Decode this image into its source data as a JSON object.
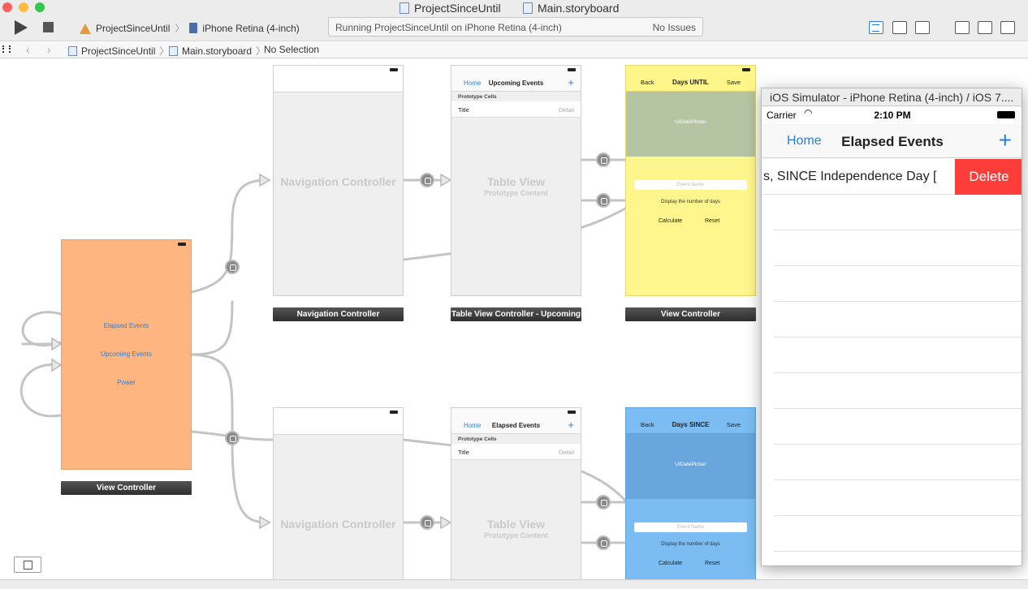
{
  "window": {
    "project_doc": "ProjectSinceUntil",
    "storyboard_doc": "Main.storyboard"
  },
  "toolbar": {
    "scheme": "ProjectSinceUntil",
    "device": "iPhone Retina (4-inch)",
    "status": "Running ProjectSinceUntil on iPhone Retina (4-inch)",
    "issues": "No Issues"
  },
  "jumpbar": {
    "project": "ProjectSinceUntil",
    "file": "Main.storyboard",
    "selection": "No Selection"
  },
  "storyboard": {
    "root_vc": {
      "buttons": [
        "Elapsed Events",
        "Upcoming Events",
        "Power"
      ],
      "label": "View Controller",
      "color": "#ffb57f"
    },
    "nav_top": {
      "watermark": "Navigation Controller",
      "label": "Navigation Controller"
    },
    "table_top": {
      "nav_left": "Home",
      "nav_title": "Upcoming Events",
      "nav_right": "+",
      "prototype": "Prototype Cells",
      "cell_title": "Title",
      "cell_detail": "Detail",
      "watermark": "Table View",
      "watermark_sub": "Prototype Content",
      "label": "Table View Controller - Upcoming"
    },
    "vc_until": {
      "back": "Back",
      "title": "Days UNTIL",
      "save": "Save",
      "picker": "UIDatePicker",
      "placeholder": "Event Name",
      "info": "Display the number of days",
      "calc": "Calculate",
      "reset": "Reset",
      "label": "View Controller",
      "color": "#fff78d",
      "picker_color": "#b5c4a3"
    },
    "nav_bottom": {
      "watermark": "Navigation Controller"
    },
    "table_bottom": {
      "nav_left": "Home",
      "nav_title": "Elapsed Events",
      "nav_right": "+",
      "prototype": "Prototype Cells",
      "cell_title": "Title",
      "cell_detail": "Detail",
      "watermark": "Table View",
      "watermark_sub": "Prototype Content"
    },
    "vc_since": {
      "back": "Back",
      "title": "Days SINCE",
      "save": "Save",
      "picker": "UIDatePicker",
      "placeholder": "Event Name",
      "info": "Display the number of days",
      "calc": "Calculate",
      "reset": "Reset",
      "color": "#7bbcf2",
      "picker_color": "#6aa6de"
    }
  },
  "simulator": {
    "title": "iOS Simulator - iPhone Retina (4-inch) / iOS 7....",
    "carrier": "Carrier",
    "time": "2:10 PM",
    "nav_back": "Home",
    "nav_title": "Elapsed Events",
    "nav_add": "+",
    "row_text": "s, SINCE Independence Day [",
    "delete": "Delete"
  }
}
